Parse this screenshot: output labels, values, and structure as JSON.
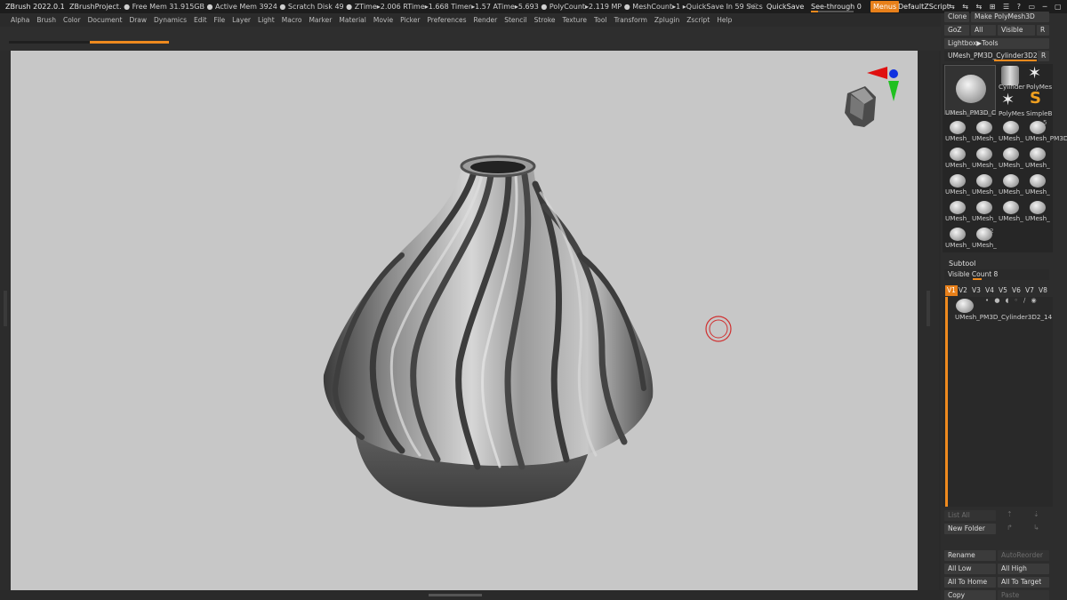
{
  "titlebar": {
    "app": "ZBrush 2022.0.1",
    "project": "ZBrushProject",
    "stats": ". ● Free Mem 31.915GB ● Active Mem 3924 ● Scratch Disk 49 ● ZTime▸2.006 RTime▸1.668 Timer▸1.57 ATime▸5.693 ● PolyCount▸2.119 MP ● MeshCount▸1 ▸QuickSave In 59 Secs",
    "ac": "AC",
    "quicksave": "QuickSave",
    "see_through": "See-through  0",
    "menus": "Menus",
    "script": "DefaultZScript",
    "window_icons": "⇆ ⇆ ⇆ ⊞ ☰ ? ▭ ─ ▢ ✕"
  },
  "menu_items": [
    "Alpha",
    "Brush",
    "Color",
    "Document",
    "Draw",
    "Dynamics",
    "Edit",
    "File",
    "Layer",
    "Light",
    "Macro",
    "Marker",
    "Material",
    "Movie",
    "Picker",
    "Preferences",
    "Render",
    "Stencil",
    "Stroke",
    "Texture",
    "Tool",
    "Transform",
    "Zplugin",
    "Zscript",
    "Help"
  ],
  "tool": {
    "clone": "Clone",
    "make_polymesh": "Make PolyMesh3D",
    "goz": "GoZ",
    "all": "All",
    "visible": "Visible",
    "r": "R",
    "lightbox": "Lightbox▶Tools",
    "current_tool": "UMesh_PM3D_Cylinder3D2_1",
    "current_r": "R",
    "main_label": "UMesh_PM3D_C",
    "cylinder": "Cylinder",
    "polymesh": "PolyMes",
    "polymesh2": "PolyMes",
    "simpleb": "SimpleB",
    "rows": [
      [
        "UMesh_",
        "UMesh_",
        "UMesh_",
        "UMesh_PM3D_C"
      ],
      [
        "UMesh_",
        "UMesh_",
        "UMesh_",
        "UMesh_"
      ],
      [
        "UMesh_",
        "UMesh_",
        "UMesh_",
        "UMesh_"
      ],
      [
        "UMesh_",
        "UMesh_",
        "UMesh_",
        "UMesh_"
      ],
      [
        "UMesh_",
        "UMesh_"
      ]
    ],
    "badge_5": "5",
    "badge_2": "2"
  },
  "subtool": {
    "title": "Subtool",
    "visible_count": "Visible Count 8",
    "tabs": [
      "V1",
      "V2",
      "V3",
      "V4",
      "V5",
      "V6",
      "V7",
      "V8"
    ],
    "item_name": "UMesh_PM3D_Cylinder3D2_14",
    "list_all": "List All",
    "new_folder": "New Folder",
    "rename": "Rename",
    "autoreorder": "AutoReorder",
    "all_low": "All Low",
    "all_high": "All High",
    "all_to_home": "All To Home",
    "all_to_target": "All To Target",
    "copy": "Copy",
    "paste": "Paste"
  },
  "colors": {
    "accent": "#ef8a1e",
    "canvas": "#c7c7c7",
    "gizmo_x": "#e01010",
    "gizmo_y": "#20c020",
    "gizmo_z": "#1030e0",
    "cursor": "#d03030"
  }
}
